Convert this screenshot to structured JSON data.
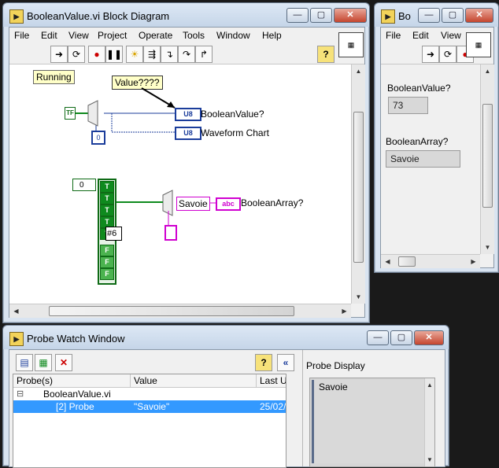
{
  "block_diagram": {
    "title": "BooleanValue.vi Block Diagram",
    "menu": [
      "File",
      "Edit",
      "View",
      "Project",
      "Operate",
      "Tools",
      "Window",
      "Help"
    ],
    "running_label": "Running",
    "probe_label": "Value????",
    "indicator1_type": "U8",
    "indicator1_label": "BooleanValue?",
    "indicator2_type": "U8",
    "indicator2_label": "Waveform Chart",
    "bool_const": "TF",
    "index_const": "0",
    "array_index": "0",
    "array_values": [
      "T",
      "T",
      "T",
      "T",
      "T",
      "F",
      "F",
      "F"
    ],
    "array_tip": "#6",
    "select_value": "Savoie",
    "array_indicator_type": "abc",
    "array_indicator_label": "BooleanArray?"
  },
  "front_panel": {
    "title": "Bo",
    "menu": [
      "File",
      "Edit",
      "View"
    ],
    "boolean_value_label": "BooleanValue?",
    "boolean_value": "73",
    "boolean_array_label": "BooleanArray?",
    "boolean_array_value": "Savoie"
  },
  "probe_watch": {
    "title": "Probe Watch Window",
    "columns": [
      "Probe(s)",
      "Value",
      "Last U"
    ],
    "rows": [
      {
        "probe": "BooleanValue.vi",
        "value": "",
        "last": ""
      },
      {
        "probe": "[2] Probe",
        "value": "\"Savoie\"",
        "last": "25/02/"
      }
    ],
    "display_title": "Probe Display",
    "display_value": "Savoie",
    "expander": "⊟"
  },
  "icons": {
    "help": "?",
    "collapse": "«",
    "delete": "✕"
  },
  "colors": {
    "selection": "#3399ff",
    "boolean_wire": "#0f8a1e",
    "numeric_wire": "#1b3d9b",
    "string_wire": "#d000d0"
  }
}
